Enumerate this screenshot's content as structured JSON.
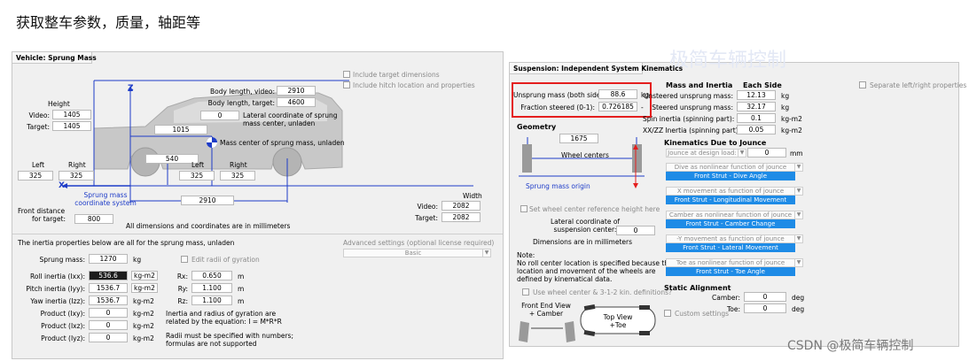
{
  "heading": "获取整车参数，质量，轴距等",
  "left": {
    "title": "Vehicle: Sprung Mass",
    "include_target_dimensions": "Include target dimensions",
    "include_hitch": "Include hitch location and properties",
    "body_length_video_label": "Body length, video:",
    "body_length_video": "2910",
    "body_length_target_label": "Body length, target:",
    "body_length_target": "4600",
    "lateral_coord": "0",
    "lateral_coord_label_1": "Lateral coordinate of sprung",
    "lateral_coord_label_2": "mass center, unladen",
    "height_label": "Height",
    "video_label": "Video:",
    "height_video": "1405",
    "target_label": "Target:",
    "height_target": "1405",
    "cg_x": "1015",
    "mass_center_label": "Mass center of sprung mass, unladen",
    "cg_z": "540",
    "z_axis": "Z",
    "x_axis": "X",
    "front_left_label": "Left",
    "front_right_label": "Right",
    "front_left": "325",
    "front_right": "325",
    "rear_left_label": "Left",
    "rear_right_label": "Right",
    "rear_left": "325",
    "rear_right": "325",
    "sprung_mass_coord_1": "Sprung mass",
    "sprung_mass_coord_2": "coordinate system",
    "wheelbase": "2910",
    "width_label": "Width",
    "width_video_label": "Video:",
    "width_video": "2082",
    "width_target_label": "Target:",
    "width_target": "2082",
    "front_distance_label_1": "Front distance",
    "front_distance_label_2": "for target:",
    "front_distance": "800",
    "dims_note": "All dimensions and coordinates are in millimeters",
    "inertia_note": "The inertia properties below are all for the sprung mass, unladen",
    "advanced_label": "Advanced settings (optional license required)",
    "advanced_value": "Basic",
    "sprung_mass_label": "Sprung mass:",
    "sprung_mass": "1270",
    "sprung_mass_unit": "kg",
    "edit_radii": "Edit radii of gyration",
    "roll_label": "Roll inertia (Ixx):",
    "roll": "536.6",
    "pitch_label": "Pitch inertia (Iyy):",
    "pitch": "1536.7",
    "yaw_label": "Yaw inertia (Izz):",
    "yaw": "1536.7",
    "pxy_label": "Product (Ixy):",
    "pxy": "0",
    "pxz_label": "Product (Ixz):",
    "pxz": "0",
    "pyz_label": "Product (Iyz):",
    "pyz": "0",
    "kgm2": "kg-m2",
    "rx_label": "Rx:",
    "rx": "0.650",
    "ry_label": "Ry:",
    "ry": "1.100",
    "rz_label": "Rz:",
    "rz": "1.100",
    "m_unit": "m",
    "gyr_note_1": "Inertia and radius of gyration are",
    "gyr_note_2": "related by the equation: I = M*R*R",
    "radii_note_1": "Radii must be specified with numbers;",
    "radii_note_2": "formulas are not supported"
  },
  "right": {
    "title": "Suspension: Independent System Kinematics",
    "unsprung_label": "Unsprung mass (both sides):",
    "unsprung": "88.6",
    "unsprung_unit": "kg",
    "fraction_label": "Fraction steered (0-1):",
    "fraction": "0.726185",
    "fraction_unit": "-",
    "mass_inertia": "Mass and Inertia",
    "each_side": "Each Side",
    "unsteered_label": "Unsteered unsprung mass:",
    "unsteered": "12.13",
    "steered_label": "Steered unsprung mass:",
    "steered": "32.17",
    "spin_label": "Spin inertia (spinning part):",
    "spin": "0.1",
    "xxzz_label": "XX/ZZ Inertia (spinning part):",
    "xxzz": "0.05",
    "kg": "kg",
    "kgm2": "kg-m2",
    "separate_lr": "Separate left/right properties",
    "geometry": "Geometry",
    "track": "1675",
    "wheel_centers": "Wheel centers",
    "sprung_mass_origin": "Sprung mass origin",
    "set_wheel_center": "Set wheel center reference height here",
    "lat_coord_1": "Lateral coordinate of",
    "lat_coord_2": "suspension center:",
    "lat_coord": "0",
    "dims_mm": "Dimensions are in millimeters",
    "note_title": "Note:",
    "note_1": "No roll center location is specified because the",
    "note_2": "location and movement of the wheels are",
    "note_3": "defined by  kinematical data.",
    "use_wheel_center": "Use wheel center & 3-1-2 kin. definitions?",
    "front_end_view_1": "Front End View",
    "front_end_view_2": "+ Camber",
    "top_view_1": "Top View",
    "top_view_2": "+Toe",
    "kin_title": "Kinematics Due to Jounce",
    "jounce_label": "Jounce at design load:",
    "jounce": "0",
    "mm": "mm",
    "dive_dd": "Dive as nonlinear function of jounce",
    "dive": "Front Strut - Dive Angle",
    "xmove_dd": "X movement as function of jounce",
    "xmove": "Front Strut -  Longitudinal Movement",
    "camber_dd": "Camber as nonlinear function of jounce",
    "camber_fn": "Front Strut - Camber Change",
    "ymove_dd": "-Y movement as function of jounce",
    "ymove": "Front Strut - Lateral Movement",
    "toe_dd": "Toe as nonlinear function of jounce",
    "toe_fn": "Front Strut - Toe Angle",
    "static_title": "Static Alignment",
    "camber_label": "Camber:",
    "camber": "0",
    "toe_label": "Toe:",
    "toe": "0",
    "deg": "deg",
    "custom_settings": "Custom settings",
    "bg_watermark": "极简车辆控制"
  },
  "watermark": "CSDN @极简车辆控制",
  "colors": {
    "blue": "#1e3cc8",
    "accent": "#1e8be6",
    "red": "#e41e1e"
  }
}
